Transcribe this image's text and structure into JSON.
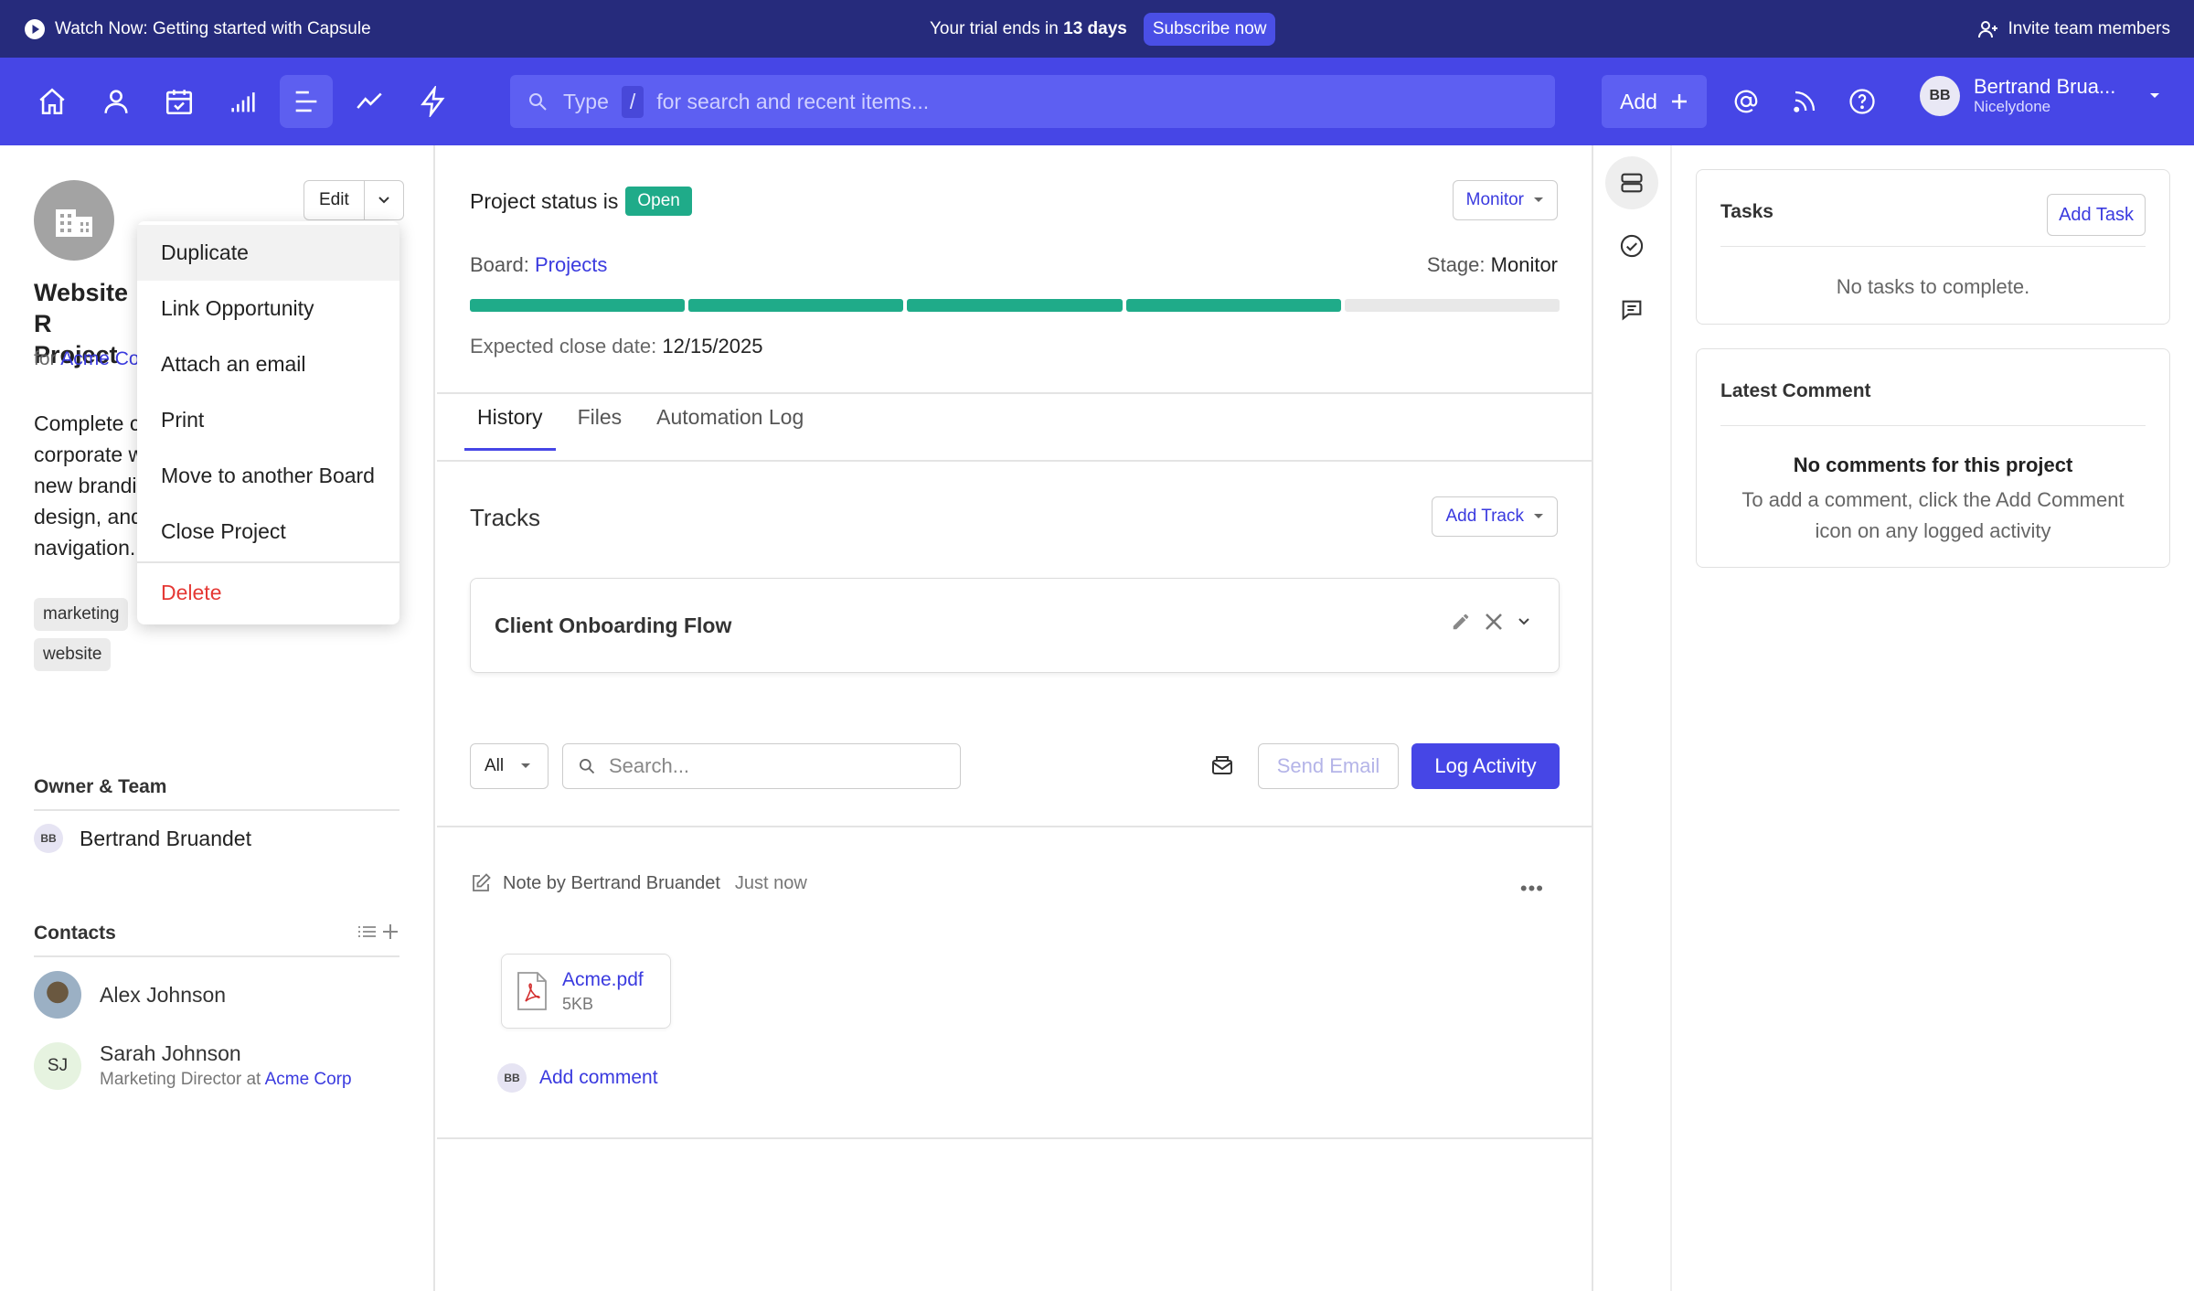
{
  "banner": {
    "watch_label": "Watch Now: Getting started with Capsule",
    "trial_prefix": "Your trial ends in",
    "trial_days": "13 days",
    "subscribe_label": "Subscribe now",
    "invite_label": "Invite team members"
  },
  "nav": {
    "icons": [
      "home-icon",
      "person-icon",
      "calendar-icon",
      "reports-icon",
      "projects-icon",
      "trends-icon",
      "automation-icon"
    ],
    "active_icon": "projects-icon",
    "search_prefix": "Type",
    "search_key": "/",
    "search_suffix": "for search and recent items...",
    "add_label": "Add",
    "user": {
      "initials": "BB",
      "name": "Bertrand Brua...",
      "org": "Nicelydone"
    }
  },
  "left": {
    "edit_label": "Edit",
    "title": "Website R… Project",
    "title_line1": "Website R",
    "title_line2": "Project",
    "for_prefix": "for",
    "for_link": "Acme Co",
    "description_lines": [
      "Complete c",
      "corporate w",
      "new brandi",
      "design, and",
      "navigation."
    ],
    "tags": [
      "marketing",
      "website"
    ],
    "owner_heading": "Owner & Team",
    "owner": {
      "initials": "BB",
      "name": "Bertrand Bruandet"
    },
    "contacts_heading": "Contacts",
    "contacts": [
      {
        "name": "Alex Johnson"
      },
      {
        "initials": "SJ",
        "name": "Sarah Johnson",
        "role_prefix": "Marketing Director at",
        "company": "Acme Corp"
      }
    ]
  },
  "menu": {
    "items": [
      "Duplicate",
      "Link Opportunity",
      "Attach an email",
      "Print",
      "Move to another Board",
      "Close Project"
    ],
    "danger_item": "Delete"
  },
  "center": {
    "status_prefix": "Project status is",
    "status_badge": "Open",
    "monitor_label": "Monitor",
    "board_prefix": "Board:",
    "board_link": "Projects",
    "stage_prefix": "Stage:",
    "stage_value": "Monitor",
    "progress": {
      "total_segments": 5,
      "completed_segments": 4
    },
    "close_prefix": "Expected close date:",
    "close_value": "12/15/2025",
    "tabs": [
      "History",
      "Files",
      "Automation Log"
    ],
    "active_tab": "History",
    "tracks_heading": "Tracks",
    "add_track_label": "Add Track",
    "track_name": "Client Onboarding Flow",
    "filter_value": "All",
    "search_placeholder": "Search...",
    "send_email_label": "Send Email",
    "log_activity_label": "Log Activity",
    "note": {
      "by": "Note by Bertrand Bruandet",
      "time": "Just now",
      "file_name": "Acme.pdf",
      "file_size": "5KB",
      "commenter_initials": "BB",
      "add_comment_label": "Add comment"
    }
  },
  "right": {
    "tasks_heading": "Tasks",
    "add_task_label": "Add Task",
    "tasks_empty": "No tasks to complete.",
    "comment_heading": "Latest Comment",
    "comment_empty_title": "No comments for this project",
    "comment_empty_desc": "To add a comment, click the Add Comment icon on any logged activity"
  },
  "colors": {
    "banner": "#262b7c",
    "nav": "#4646e6",
    "accent": "#4646e6",
    "status_open": "#1fab89",
    "danger": "#e53935"
  }
}
